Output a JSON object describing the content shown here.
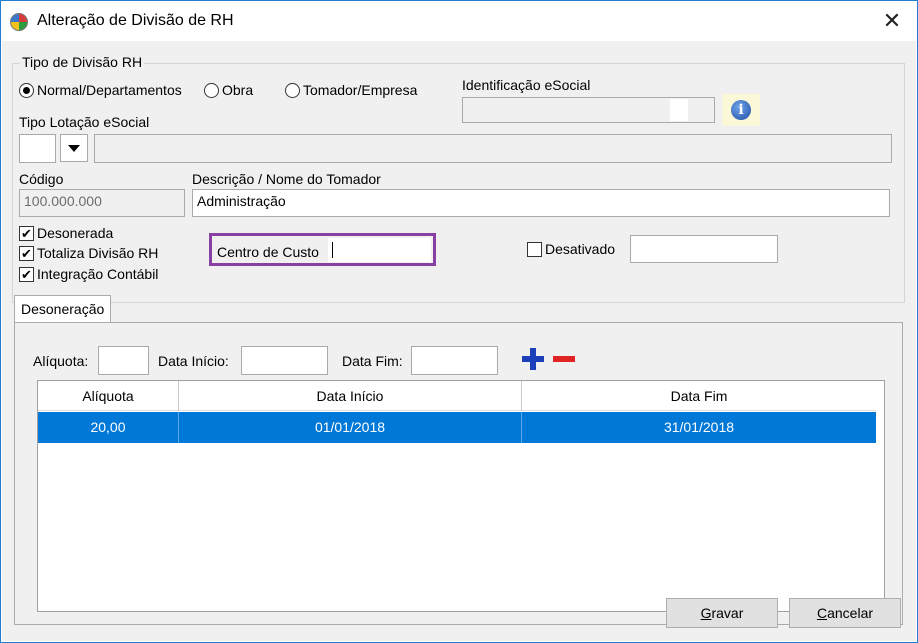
{
  "window": {
    "title": "Alteração de Divisão de RH",
    "close_glyph": "✕",
    "app_icon": "app-icon"
  },
  "tipo_divisao": {
    "legend": "Tipo de Divisão RH",
    "options": [
      {
        "label": "Normal/Departamentos",
        "selected": true
      },
      {
        "label": "Obra",
        "selected": false
      },
      {
        "label": "Tomador/Empresa",
        "selected": false
      }
    ]
  },
  "identificacao": {
    "label": "Identificação eSocial",
    "value": "",
    "info_icon": "info-icon",
    "info_glyph": "i"
  },
  "tipo_lotacao": {
    "label": "Tipo Lotação eSocial",
    "code": "",
    "description": ""
  },
  "codigo": {
    "label": "Código",
    "value": "100.000.000"
  },
  "descricao": {
    "label": "Descrição / Nome do Tomador",
    "value": "Administração"
  },
  "checks": [
    {
      "label": "Desonerada",
      "checked": true
    },
    {
      "label": "Totaliza Divisão RH",
      "checked": true
    },
    {
      "label": "Integração Contábil",
      "checked": true
    }
  ],
  "centro_custo": {
    "label": "Centro de Custo",
    "value": ""
  },
  "desativado": {
    "label": "Desativado",
    "checked": false,
    "value": ""
  },
  "tab": {
    "label": "Desoneração"
  },
  "filters": {
    "aliquota_label": "Alíquota:",
    "data_inicio_label": "Data Início:",
    "data_fim_label": "Data Fim:",
    "add_icon": "plus-icon",
    "remove_icon": "minus-icon"
  },
  "table": {
    "columns": [
      "Alíquota",
      "Data Início",
      "Data Fim"
    ],
    "rows": [
      [
        "20,00",
        "01/01/2018",
        "31/01/2018"
      ]
    ],
    "selected_color": "#0078d7"
  },
  "buttons": {
    "gravar": {
      "mnemonic": "G",
      "rest": "ravar"
    },
    "cancelar": {
      "mnemonic": "C",
      "rest": "ancelar"
    }
  },
  "colors": {
    "highlight_frame": "#8a3fa3",
    "accent": "#0078d7"
  }
}
